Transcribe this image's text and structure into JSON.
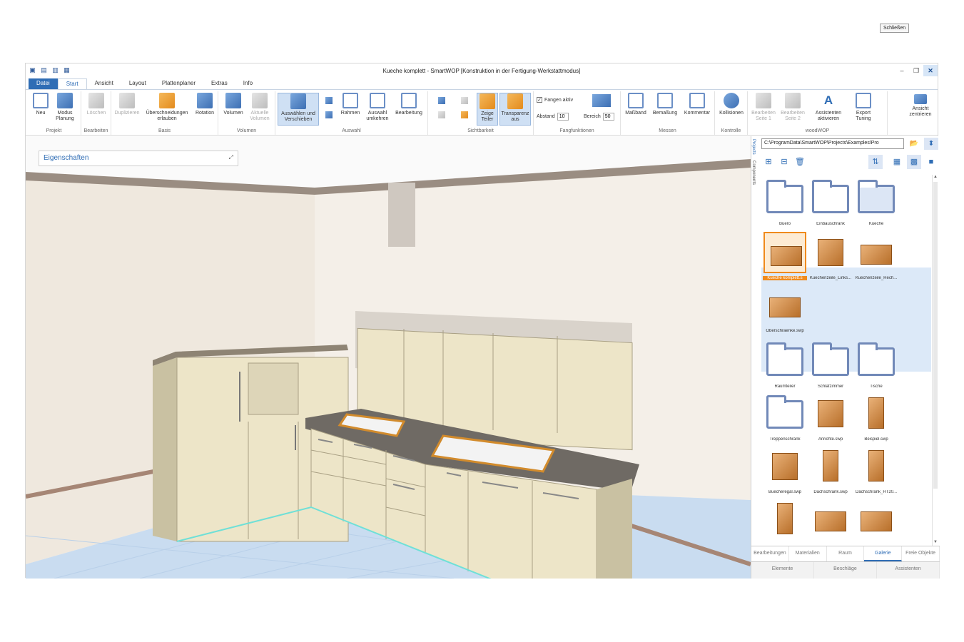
{
  "window": {
    "title": "Kueche komplett - SmartWOP [Konstruktion in der Fertigung-Werkstattmodus]",
    "tooltip": "Schließen"
  },
  "tabs": [
    "Datei",
    "Start",
    "Ansicht",
    "Layout",
    "Plattenplaner",
    "Extras",
    "Info"
  ],
  "ribbon": {
    "projekt": {
      "label": "Projekt",
      "neu": "Neu",
      "modus_planung": "Modus Planung"
    },
    "bearbeiten": {
      "label": "Bearbeiten",
      "loeschen": "Löschen"
    },
    "basis": {
      "label": "Basis",
      "duplizieren": "Duplizieren",
      "ueberschneidungen": "Überschneidungen erlauben",
      "rotation": "Rotation"
    },
    "volumen": {
      "label": "Volumen",
      "volumen": "Volumen",
      "aktuelle_volumen": "Aktuelle Volumen"
    },
    "auswahl": {
      "label": "Auswahl",
      "auswaehlen": "Auswählen und Verschieben",
      "rahmen": "Rahmen",
      "auswahl_umkehren": "Auswahl umkehren",
      "bearbeitung": "Bearbeitung"
    },
    "sichtbarkeit": {
      "label": "Sichtbarkeit",
      "zeige_teiler": "Zeige Teiler",
      "transparenz": "Transparenz aus"
    },
    "fang": {
      "label": "Fangfunktionen",
      "fangen_aktiv": "Fangen aktiv",
      "abstand_label": "Abstand",
      "abstand": "10",
      "bereich_label": "Bereich",
      "bereich": "50"
    },
    "messen": {
      "label": "Messen",
      "massband": "Maßband",
      "bemassung": "Bemaßung",
      "kommentar": "Kommentar"
    },
    "kontrolle": {
      "label": "Kontrolle",
      "kollisionen": "Kollisionen"
    },
    "woodwop": {
      "label": "woodWOP",
      "seite1": "Bearbeiten Seite 1",
      "seite2": "Bearbeiten Seite 2",
      "assistenten": "Assistenten aktivieren",
      "export": "Export Tuning"
    },
    "ansicht": {
      "zentrieren": "Ansicht zentrieren"
    }
  },
  "properties_panel": {
    "title": "Eigenschaften"
  },
  "panel": {
    "vertical_tabs": [
      "Projects",
      "Components"
    ],
    "path": "C:\\ProgramData\\SmartWOP\\Projects\\Examples\\Pro",
    "folders_top": [
      "Buero",
      "Einbauschrank",
      "Kueche"
    ],
    "files_kueche": [
      "Kueche komplett.s",
      "Kuechenzeile_Links...",
      "Kuechenzeile_Rech...",
      "Oberschraenke.swp"
    ],
    "folders_bottom": [
      "Raumteiler",
      "Schlafzimmer",
      "Tische",
      "Treppenschrank"
    ],
    "files_bottom": [
      "Anrichte.swp",
      "Beispiel.swp",
      "Buecheregal.swp",
      "Dachschrank.swp",
      "Dachschrank_HT20..."
    ],
    "tabs_row1": [
      "Bearbeitungen",
      "Materialien",
      "Raum",
      "Galerie",
      "Freie Objekte"
    ],
    "tabs_row1_active": "Galerie",
    "tabs_row2": [
      "Elemente",
      "Beschläge",
      "Assistenten"
    ]
  },
  "colors": {
    "accent": "#2f6db5",
    "selection": "#f08a1c",
    "cabinet": "#ede5c8",
    "floor": "#c9dcf0"
  }
}
